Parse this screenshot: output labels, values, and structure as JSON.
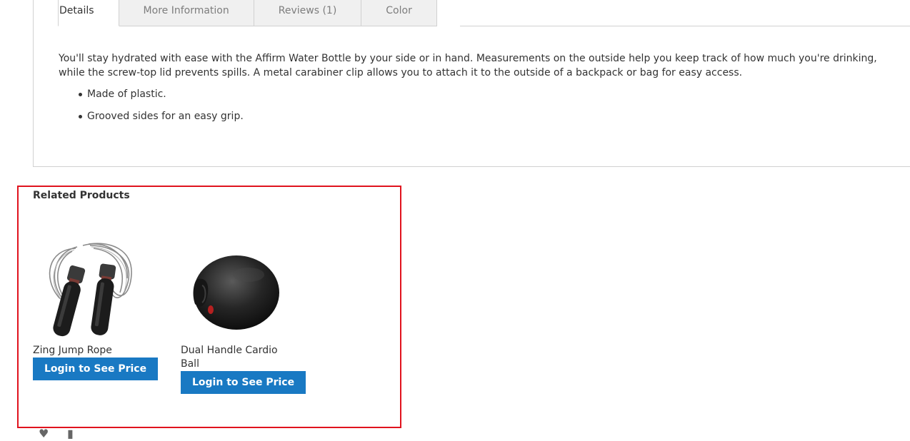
{
  "tabs": [
    {
      "label": "Details",
      "active": true
    },
    {
      "label": "More Information",
      "active": false
    },
    {
      "label": "Reviews (1)",
      "active": false
    },
    {
      "label": "Color",
      "active": false
    }
  ],
  "details": {
    "description": "You'll stay hydrated with ease with the Affirm Water Bottle by your side or in hand. Measurements on the outside help you keep track of how much you're drinking, while the screw-top lid prevents spills. A metal carabiner clip allows you to attach it to the outside of a backpack or bag for easy access.",
    "bullets": [
      "Made of plastic.",
      "Grooved sides for an easy grip."
    ]
  },
  "related": {
    "title": "Related Products",
    "products": [
      {
        "name": "Zing Jump Rope",
        "button": "Login to See Price",
        "icon": "jump-rope-image"
      },
      {
        "name": "Dual Handle Cardio Ball",
        "button": "Login to See Price",
        "icon": "cardio-ball-image"
      }
    ]
  },
  "colors": {
    "accent": "#1979c3",
    "highlight_border": "#e0131e",
    "tab_inactive_bg": "#f0f0f0"
  }
}
